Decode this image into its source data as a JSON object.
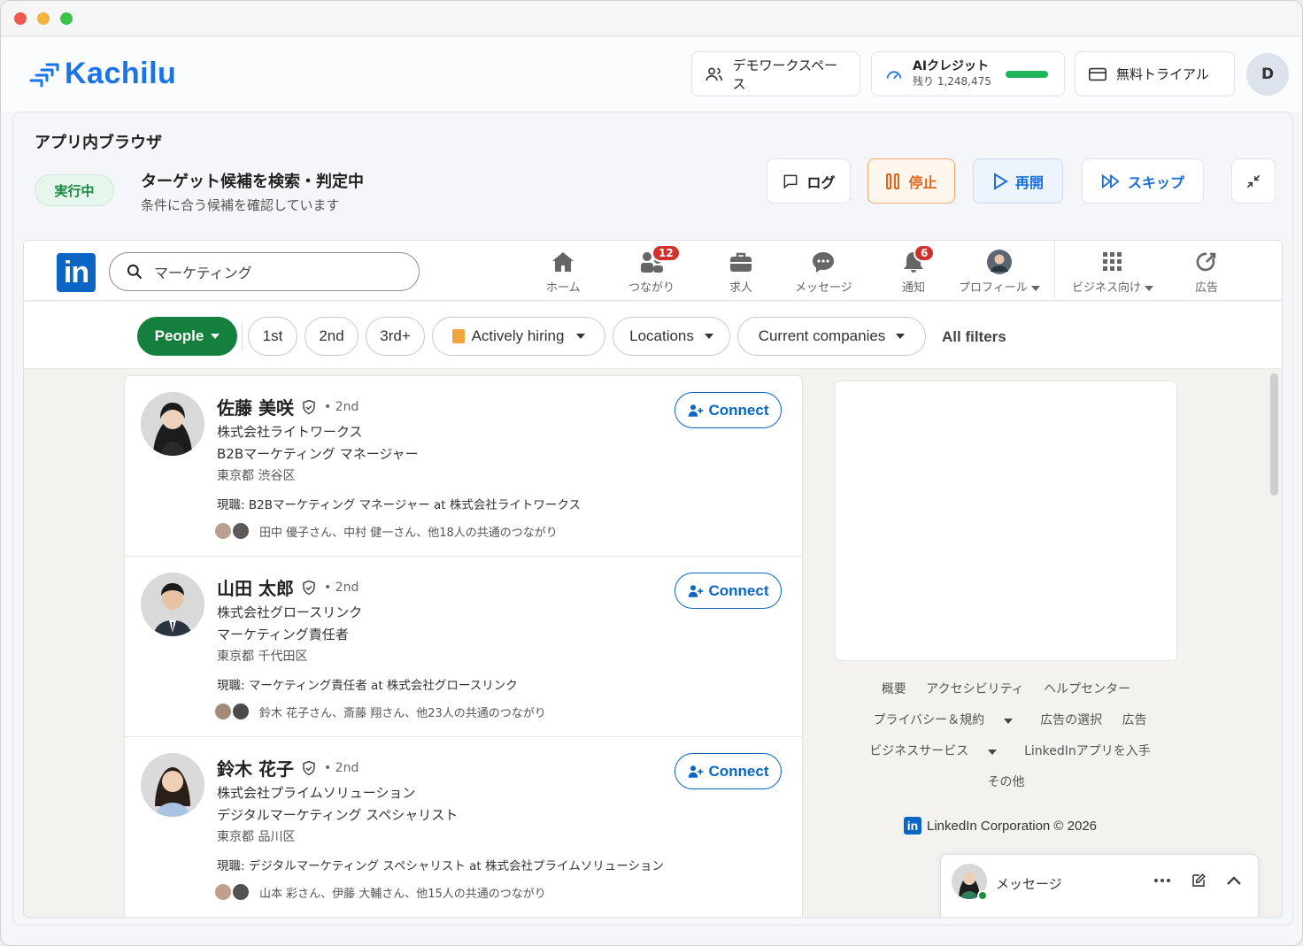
{
  "app": {
    "brand": "Kachilu",
    "workspace_label": "デモワークスペース",
    "credit_title": "AIクレジット",
    "credit_remaining": "残り 1,248,475",
    "trial_label": "無料トライアル",
    "avatar_initial": "D",
    "colors": {
      "brand": "#1a73e8",
      "running": "#188a44",
      "stop": "#e4661c",
      "resume": "#1a6fe0"
    }
  },
  "panel": {
    "title": "アプリ内ブラウザ",
    "status": "実行中",
    "task_title": "ターゲット候補を検索・判定中",
    "task_sub": "条件に合う候補を確認しています",
    "buttons": {
      "log": "ログ",
      "stop": "停止",
      "resume": "再開",
      "skip": "スキップ"
    }
  },
  "linkedin": {
    "search_value": "マーケティング",
    "nav": [
      {
        "label": "ホーム",
        "icon": "home-icon"
      },
      {
        "label": "つながり",
        "icon": "network-icon",
        "badge": "12"
      },
      {
        "label": "求人",
        "icon": "briefcase-icon"
      },
      {
        "label": "メッセージ",
        "icon": "message-icon"
      },
      {
        "label": "通知",
        "icon": "bell-icon",
        "badge": "6"
      },
      {
        "label": "プロフィール",
        "icon": "profile-avatar"
      },
      {
        "label": "ビジネス向け",
        "icon": "grid-icon"
      },
      {
        "label": "広告",
        "icon": "ads-icon"
      }
    ],
    "filters": {
      "people": "People",
      "first": "1st",
      "second": "2nd",
      "third": "3rd+",
      "hiring": "Actively hiring",
      "locations": "Locations",
      "companies": "Current companies",
      "all": "All filters"
    },
    "connect_label": "Connect",
    "results": [
      {
        "name": "佐藤 美咲",
        "degree": "• 2nd",
        "company": "株式会社ライトワークス",
        "title": "B2Bマーケティング マネージャー",
        "location": "東京都 渋谷区",
        "current": "現職: B2Bマーケティング マネージャー at 株式会社ライトワークス",
        "mutual": "田中 優子さん、中村 健一さん、他18人の共通のつながり"
      },
      {
        "name": "山田 太郎",
        "degree": "• 2nd",
        "company": "株式会社グロースリンク",
        "title": "マーケティング責任者",
        "location": "東京都 千代田区",
        "current": "現職: マーケティング責任者 at 株式会社グロースリンク",
        "mutual": "鈴木 花子さん、斎藤 翔さん、他23人の共通のつながり"
      },
      {
        "name": "鈴木 花子",
        "degree": "• 2nd",
        "company": "株式会社プライムソリューション",
        "title": "デジタルマーケティング スペシャリスト",
        "location": "東京都 品川区",
        "current": "現職: デジタルマーケティング スペシャリスト at 株式会社プライムソリューション",
        "mutual": "山本 彩さん、伊藤 大輔さん、他15人の共通のつながり"
      }
    ],
    "footer": {
      "l1": "概要",
      "l2": "アクセシビリティ",
      "l3": "ヘルプセンター",
      "l4": "プライバシー＆規約",
      "l5": "広告の選択",
      "l6": "広告",
      "l7": "ビジネスサービス",
      "l8": "LinkedInアプリを入手",
      "l9": "その他",
      "corp": "LinkedIn Corporation © 2026"
    },
    "messaging_label": "メッセージ"
  }
}
